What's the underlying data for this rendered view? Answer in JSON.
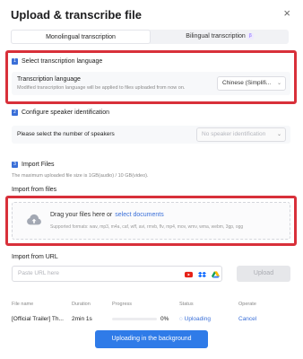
{
  "dialog": {
    "title": "Upload & transcribe file",
    "close_icon": "×"
  },
  "tabs": [
    {
      "label": "Monolingual transcription",
      "active": true
    },
    {
      "label": "Bilingual transcription",
      "badge": "β",
      "active": false
    }
  ],
  "section1": {
    "number": "1",
    "heading": "Select transcription language",
    "row_label": "Transcription language",
    "row_sub": "Modified transcription language will be applied to files uploaded from now on.",
    "select_value": "Chinese (Simplifi...",
    "chevron": "⌄"
  },
  "section2": {
    "number": "2",
    "heading": "Configure speaker identification",
    "row_label": "Please select the number of speakers",
    "select_placeholder": "No speaker identification",
    "chevron": "⌄"
  },
  "section3": {
    "number": "3",
    "heading": "Import Files",
    "note": "The maximum uploaded file size is 1GB(audio) / 10 GB(video).",
    "import_files_label": "Import from files",
    "drop_text": "Drag your files here or",
    "select_link": "select documents",
    "formats": "Supported formats: wav, mp3, m4a, caf, wff, avi, rmvb, flv, mp4, mov, wmv, wma, webm, 3gp, ogg",
    "import_url_label": "Import from URL",
    "url_placeholder": "Paste URL here",
    "upload_button": "Upload"
  },
  "table": {
    "headers": [
      "File name",
      "Duration",
      "Progress",
      "Status",
      "Operate"
    ],
    "rows": [
      {
        "file_name": "[Official Trailer] Th...",
        "duration": "2min 1s",
        "progress_text": "0%",
        "progress": 0.0,
        "status": "Uploading",
        "operate": "Cancel"
      }
    ]
  },
  "footer": {
    "button": "Uploading in the background"
  },
  "colors": {
    "accent": "#3a6fd8",
    "highlight_box": "#d8303a",
    "primary_button": "#2f7be8"
  }
}
